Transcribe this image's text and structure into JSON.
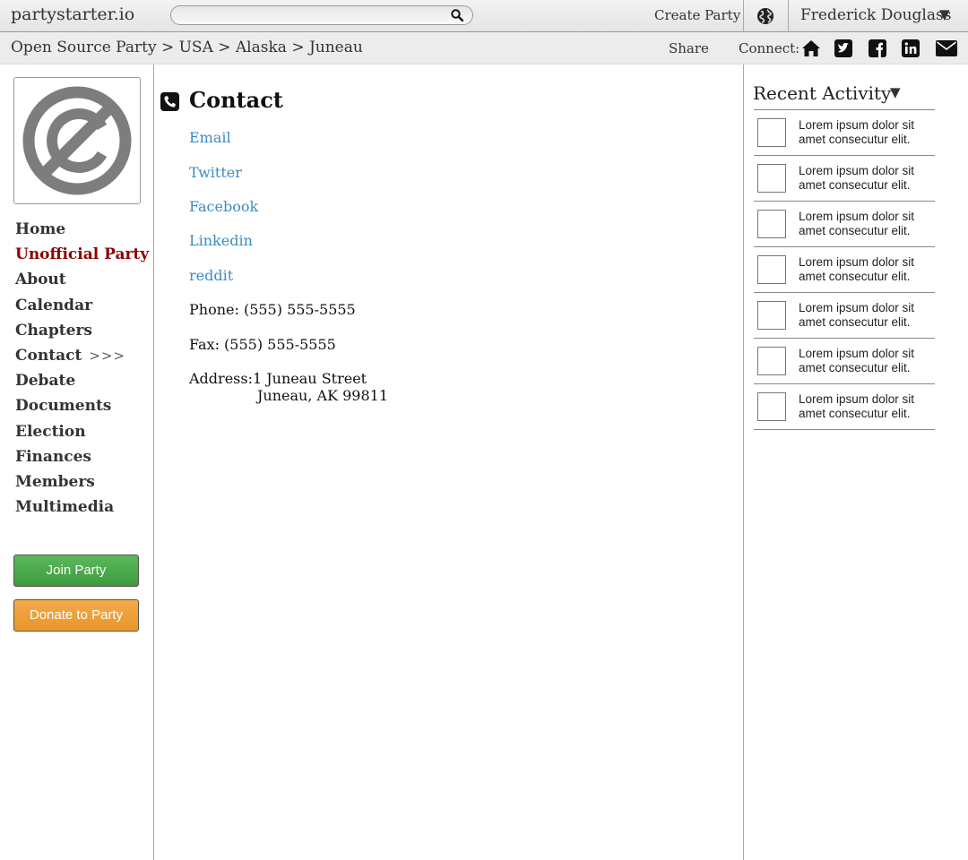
{
  "topbar": {
    "logo": "partystarter.io",
    "create_label": "Create Party",
    "user_name": "Frederick Douglass",
    "user_caret": "▼"
  },
  "breadcrumb": {
    "path": "Open Source Party > USA > Alaska > Juneau",
    "share_label": "Share",
    "connect_label": "Connect:"
  },
  "sidebar": {
    "items": [
      {
        "label": "Home"
      },
      {
        "label": "Unofficial Party"
      },
      {
        "label": "About"
      },
      {
        "label": "Calendar"
      },
      {
        "label": "Chapters"
      },
      {
        "label": "Contact",
        "marker": ">>>"
      },
      {
        "label": "Debate"
      },
      {
        "label": "Documents"
      },
      {
        "label": "Election"
      },
      {
        "label": "Finances"
      },
      {
        "label": "Members"
      },
      {
        "label": "Multimedia"
      }
    ],
    "join_label": "Join Party",
    "donate_label": "Donate to Party"
  },
  "main": {
    "title": "Contact",
    "links": [
      "Email",
      "Twitter",
      "Facebook",
      "Linkedin",
      "reddit"
    ],
    "phone": "Phone: (555) 555-5555",
    "fax": "Fax: (555) 555-5555",
    "address_label": "Address:",
    "address_line1": "1 Juneau Street",
    "address_line2": "Juneau, AK 99811"
  },
  "activity": {
    "title": "Recent Activity",
    "caret": "▼",
    "items": [
      "Lorem ipsum dolor sit amet consecutur elit.",
      "Lorem ipsum dolor sit amet consecutur elit.",
      "Lorem ipsum dolor sit amet consecutur elit.",
      "Lorem ipsum dolor sit amet consecutur elit.",
      "Lorem ipsum dolor sit amet consecutur elit.",
      "Lorem ipsum dolor sit amet consecutur elit.",
      "Lorem ipsum dolor sit amet consecutur elit."
    ]
  },
  "colors": {
    "active_nav": "#8b0000",
    "link": "#3b8bc4",
    "join_button": "#4cae4c",
    "donate_button": "#f0a23c"
  },
  "icons": [
    "search-icon",
    "globe-icon",
    "home-icon",
    "twitter-icon",
    "facebook-icon",
    "linkedin-icon",
    "mail-icon",
    "phone-icon",
    "no-copyright-icon"
  ]
}
